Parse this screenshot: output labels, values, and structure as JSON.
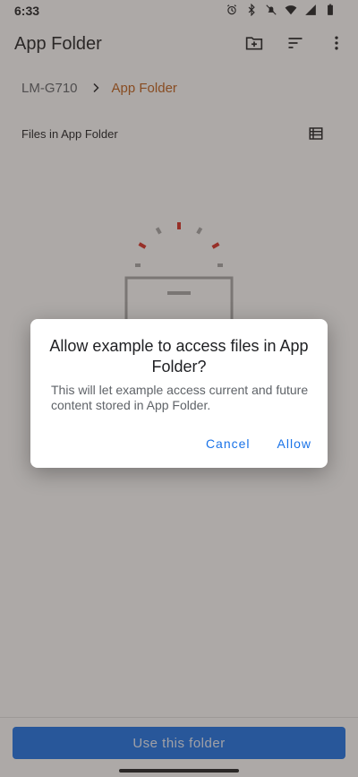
{
  "status_bar": {
    "time": "6:33",
    "icons": [
      "alarm-icon",
      "bluetooth-icon",
      "mute-icon",
      "wifi-icon",
      "signal-icon",
      "battery-icon"
    ]
  },
  "toolbar": {
    "title": "App Folder",
    "actions": [
      "create-folder-icon",
      "sort-icon",
      "more-options-icon"
    ]
  },
  "breadcrumb": {
    "root": "LM-G710",
    "current": "App Folder"
  },
  "files_header": "Files in App Folder",
  "bottom": {
    "use_folder_label": "Use this folder"
  },
  "dialog": {
    "title": "Allow example to access files in App Folder?",
    "message": "This will let example access current and future content stored in App Folder.",
    "cancel_label": "Cancel",
    "allow_label": "Allow"
  },
  "colors": {
    "accent": "#1a73e8",
    "breadcrumb_current": "#c0601a",
    "illustration_accent": "#d93025"
  }
}
